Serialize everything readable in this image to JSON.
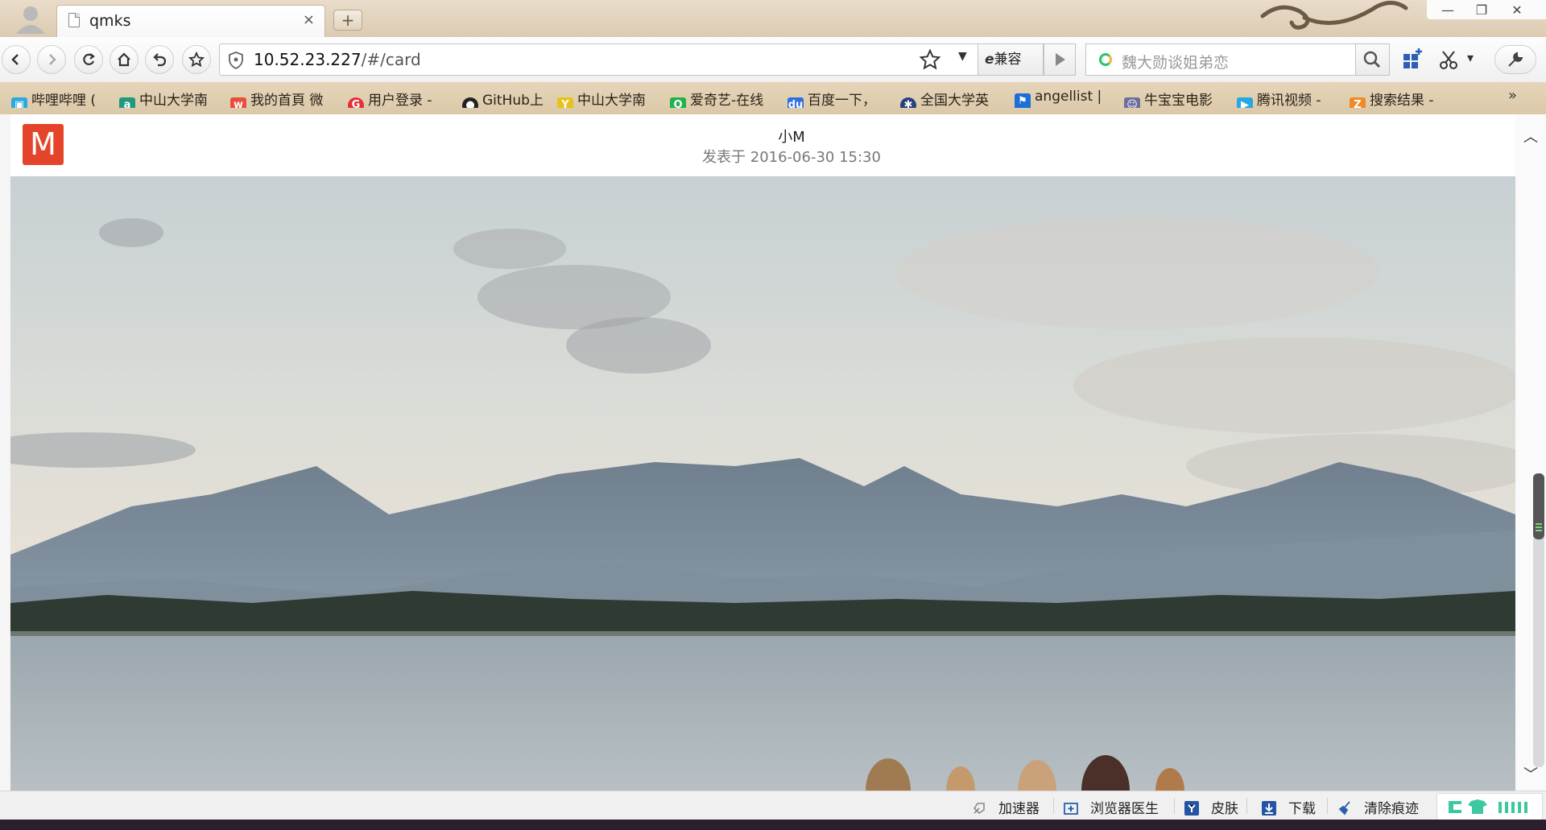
{
  "tab": {
    "title": "qmks",
    "close": "×",
    "new_tab": "+"
  },
  "window": {
    "minimize": "—",
    "restore": "❐",
    "close": "✕"
  },
  "address": {
    "host": "10.52.23.227",
    "path": "/#/card",
    "dropdown": "▼"
  },
  "compat": {
    "e": "e",
    "label": "兼容"
  },
  "search": {
    "placeholder": "魏大勋谈姐弟恋"
  },
  "toolbar": {
    "cut_drop": "▾"
  },
  "bookmarks": [
    {
      "icon": "bilibili-icon",
      "color": "#2ba8e0",
      "glyph": "▣",
      "label": "哔哩哔哩 ("
    },
    {
      "icon": "sysu-icon",
      "color": "#1f9a7c",
      "glyph": "a",
      "label": "中山大学南"
    },
    {
      "icon": "weibo-icon",
      "color": "#e84e3c",
      "glyph": "w",
      "label": "我的首頁 微"
    },
    {
      "icon": "login-icon",
      "color": "#e52f36",
      "glyph": "G",
      "label": "用户登录 - "
    },
    {
      "icon": "github-icon",
      "color": "#222222",
      "glyph": "●",
      "label": "GitHub上"
    },
    {
      "icon": "sysu-yellow-icon",
      "color": "#e7c21a",
      "glyph": "Y",
      "label": "中山大学南"
    },
    {
      "icon": "iqiyi-icon",
      "color": "#22b14c",
      "glyph": "Q",
      "label": "爱奇艺-在线"
    },
    {
      "icon": "baidu-icon",
      "color": "#2d6ee0",
      "glyph": "du",
      "label": "百度一下，"
    },
    {
      "icon": "university-icon",
      "color": "#28407e",
      "glyph": "✱",
      "label": "全国大学英"
    },
    {
      "icon": "angellist-icon",
      "color": "#1d6fd6",
      "glyph": "⚑",
      "label": "angellist | "
    },
    {
      "icon": "niubaobao-icon",
      "color": "#6b6f9c",
      "glyph": "☺",
      "label": "牛宝宝电影"
    },
    {
      "icon": "tencent-video-icon",
      "color": "#27a7e3",
      "glyph": "▶",
      "label": "腾讯视频 - "
    },
    {
      "icon": "search-result-icon",
      "color": "#f08a24",
      "glyph": "Z",
      "label": "搜索结果 - "
    }
  ],
  "bookmarks_more": "»",
  "card": {
    "logo": "M",
    "author": "小M",
    "posted": "发表于 2016-06-30 15:30"
  },
  "scroll": {
    "up": "︿",
    "down": "﹀"
  },
  "statusbar": {
    "accelerator": "加速器",
    "doctor": "浏览器医生",
    "skin": "皮肤",
    "download": "下载",
    "clear": "清除痕迹"
  },
  "colors": {
    "brand_logo": "#e4452a",
    "bookmark_bar": "#dfcdb0",
    "taskbar": "#2b1f2e"
  }
}
